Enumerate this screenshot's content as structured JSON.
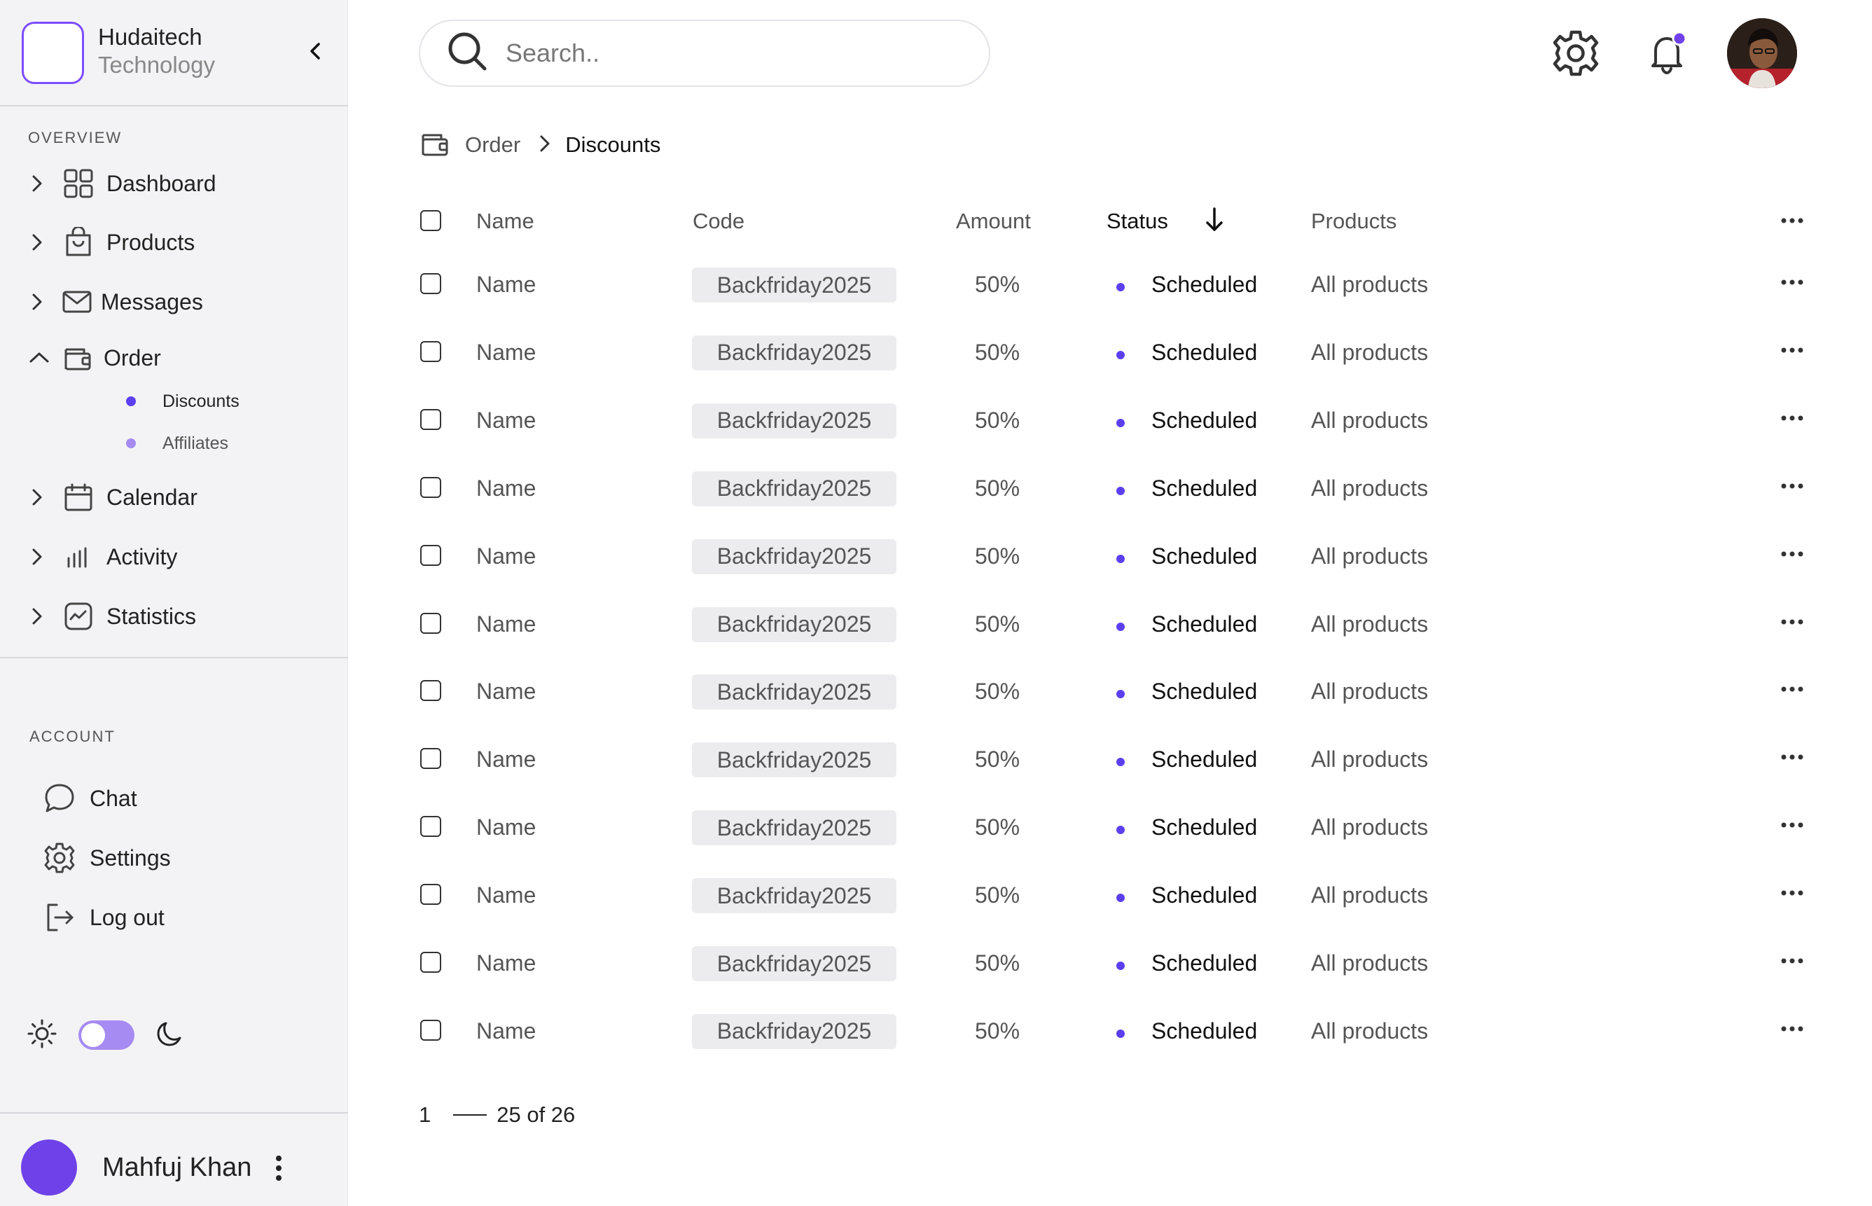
{
  "brand": {
    "name": "Hudaitech",
    "subtitle": "Technology"
  },
  "sidebar": {
    "overview_label": "OVERVIEW",
    "items": [
      {
        "label": "Dashboard",
        "icon": "dashboard-icon"
      },
      {
        "label": "Products",
        "icon": "shopping-bag-icon"
      },
      {
        "label": "Messages",
        "icon": "mail-icon"
      },
      {
        "label": "Order",
        "icon": "wallet-icon",
        "expanded": true
      },
      {
        "label": "Calendar",
        "icon": "calendar-icon"
      },
      {
        "label": "Activity",
        "icon": "bar-chart-icon"
      },
      {
        "label": "Statistics",
        "icon": "stats-icon"
      }
    ],
    "order_sub": [
      {
        "label": "Discounts",
        "active": true
      },
      {
        "label": "Affiliates",
        "active": false
      }
    ],
    "account_label": "ACCOUNT",
    "account_items": [
      {
        "label": "Chat",
        "icon": "chat-icon"
      },
      {
        "label": "Settings",
        "icon": "gear-icon"
      },
      {
        "label": "Log out",
        "icon": "logout-icon"
      }
    ],
    "theme": {
      "dark_mode": false
    }
  },
  "user": {
    "name": "Mahfuj Khan"
  },
  "search": {
    "placeholder": "Search.."
  },
  "notifications": {
    "has_unread": true
  },
  "breadcrumb": {
    "parent": "Order",
    "current": "Discounts"
  },
  "table": {
    "columns": {
      "name": "Name",
      "code": "Code",
      "amount": "Amount",
      "status": "Status",
      "products": "Products"
    },
    "sort": {
      "column": "Status",
      "direction": "desc"
    },
    "rows": [
      {
        "name": "Name",
        "code": "Backfriday2025",
        "amount": "50%",
        "status": "Scheduled",
        "products": "All products"
      },
      {
        "name": "Name",
        "code": "Backfriday2025",
        "amount": "50%",
        "status": "Scheduled",
        "products": "All products"
      },
      {
        "name": "Name",
        "code": "Backfriday2025",
        "amount": "50%",
        "status": "Scheduled",
        "products": "All products"
      },
      {
        "name": "Name",
        "code": "Backfriday2025",
        "amount": "50%",
        "status": "Scheduled",
        "products": "All products"
      },
      {
        "name": "Name",
        "code": "Backfriday2025",
        "amount": "50%",
        "status": "Scheduled",
        "products": "All products"
      },
      {
        "name": "Name",
        "code": "Backfriday2025",
        "amount": "50%",
        "status": "Scheduled",
        "products": "All products"
      },
      {
        "name": "Name",
        "code": "Backfriday2025",
        "amount": "50%",
        "status": "Scheduled",
        "products": "All products"
      },
      {
        "name": "Name",
        "code": "Backfriday2025",
        "amount": "50%",
        "status": "Scheduled",
        "products": "All products"
      },
      {
        "name": "Name",
        "code": "Backfriday2025",
        "amount": "50%",
        "status": "Scheduled",
        "products": "All products"
      },
      {
        "name": "Name",
        "code": "Backfriday2025",
        "amount": "50%",
        "status": "Scheduled",
        "products": "All products"
      },
      {
        "name": "Name",
        "code": "Backfriday2025",
        "amount": "50%",
        "status": "Scheduled",
        "products": "All products"
      },
      {
        "name": "Name",
        "code": "Backfriday2025",
        "amount": "50%",
        "status": "Scheduled",
        "products": "All products"
      }
    ]
  },
  "pagination": {
    "start": "1",
    "range": "25 of 26"
  },
  "colors": {
    "accent": "#6e42e8",
    "accent_light": "#a68bf2",
    "status_dot": "#5b3ff0"
  }
}
